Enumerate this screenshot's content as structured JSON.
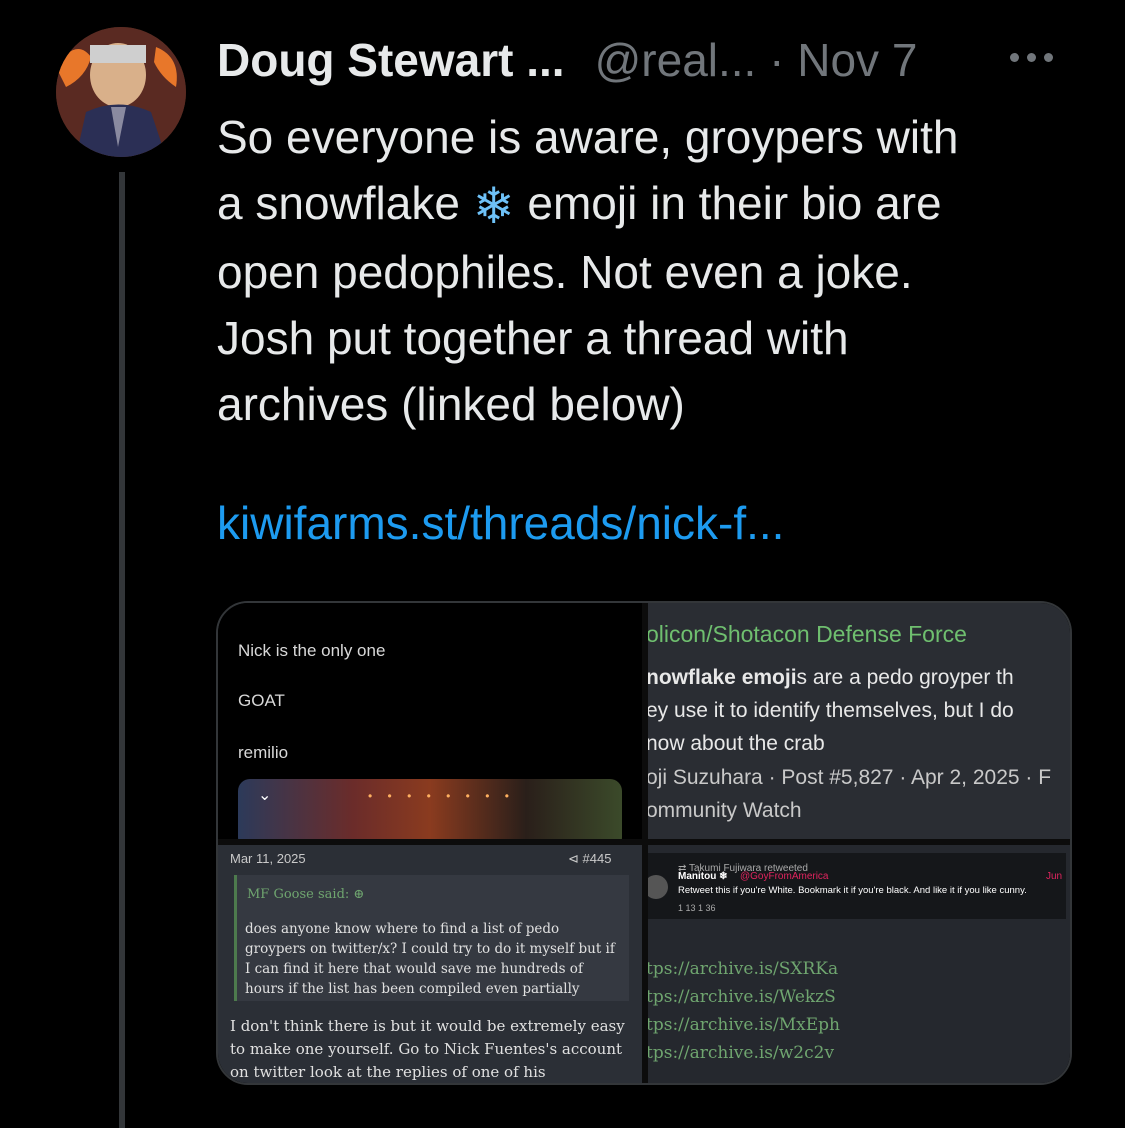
{
  "tweet": {
    "author_name": "Doug Stewart ...",
    "handle": "@real...",
    "separator": "·",
    "date": "Nov 7",
    "text_lines": [
      "So everyone is aware, groypers with",
      "a snowflake",
      "emoji in their bio are",
      "open pedophiles. Not even a joke.",
      "Josh put together a thread with",
      "archives (linked below)"
    ],
    "snowflake": "❄",
    "link": "kiwifarms.st/threads/nick-f..."
  },
  "media": {
    "q1": {
      "lines": [
        "Nick is the only one",
        "GOAT",
        "remilio"
      ]
    },
    "q2": {
      "title": "olicon/Shotacon Defense Force",
      "body_bold": "nowflake emoji",
      "body_line1_rest": "s are a pedo groyper th",
      "body_line2": "ey use it to identify themselves, but I do",
      "body_line3": "now about the crab",
      "meta_line1": "oji Suzuhara · Post #5,827 · Apr 2, 2025 · F",
      "meta_line2": "ommunity Watch"
    },
    "q3": {
      "date": "Mar 11, 2025",
      "post_number": "#445",
      "quote_author": "MF Goose said:",
      "quote_text": "does anyone know where to find a list of pedo groypers on twitter/x? I could try to do it myself but if I can find it here that would save me hundreds of hours if the list has been compiled even partially",
      "reply_text": "I don't think there is but it would be extremely easy to make one yourself. Go to Nick Fuentes's account on twitter look at the replies of one of his"
    },
    "q4": {
      "retweeted_by": "Takumi Fujiwara retweeted",
      "name": "Manitou",
      "handle": "@GoyFromAmerica",
      "date": "Jun",
      "text": "Retweet this if you're White. Bookmark it if you're black. And like it if you like cunny.",
      "stats": "1   13   1   36",
      "archives": [
        "tps://archive.is/SXRKa",
        "tps://archive.is/WekzS",
        "tps://archive.is/MxEph",
        "tps://archive.is/w2c2v"
      ]
    }
  },
  "colors": {
    "background": "#000000",
    "text": "#e7e9ea",
    "secondary": "#71767b",
    "link": "#1d9bf0",
    "forum_green": "#6fbf6f"
  }
}
